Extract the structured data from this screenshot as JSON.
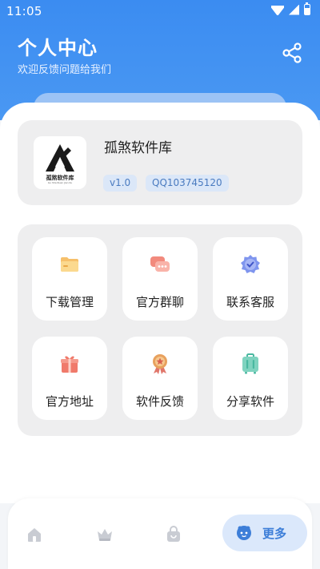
{
  "status_bar": {
    "time": "11:05"
  },
  "header": {
    "title": "个人中心",
    "subtitle": "欢迎反馈问题给我们"
  },
  "profile": {
    "name": "孤煞软件库",
    "version": "v1.0",
    "qq": "QQ103745120",
    "logo_text": "孤煞软件库",
    "logo_subtext": "Gu Sha Ruan Jian Ku"
  },
  "menu": [
    {
      "label": "下载管理",
      "icon": "folder-icon"
    },
    {
      "label": "官方群聊",
      "icon": "chat-icon"
    },
    {
      "label": "联系客服",
      "icon": "verified-badge-icon"
    },
    {
      "label": "官方地址",
      "icon": "gift-icon"
    },
    {
      "label": "软件反馈",
      "icon": "medal-icon"
    },
    {
      "label": "分享软件",
      "icon": "suitcase-icon"
    }
  ],
  "bottom_nav": {
    "items": [
      {
        "icon": "home-icon"
      },
      {
        "icon": "crown-icon"
      },
      {
        "icon": "bag-icon"
      }
    ],
    "active_label": "更多",
    "active_icon": "more-icon"
  },
  "colors": {
    "header_blue": "#3b8cf1",
    "badge_bg": "#dbe7f8",
    "badge_text": "#4a7bc0",
    "active_nav_bg": "#dbe8fb",
    "active_nav_text": "#3d7ed8"
  }
}
